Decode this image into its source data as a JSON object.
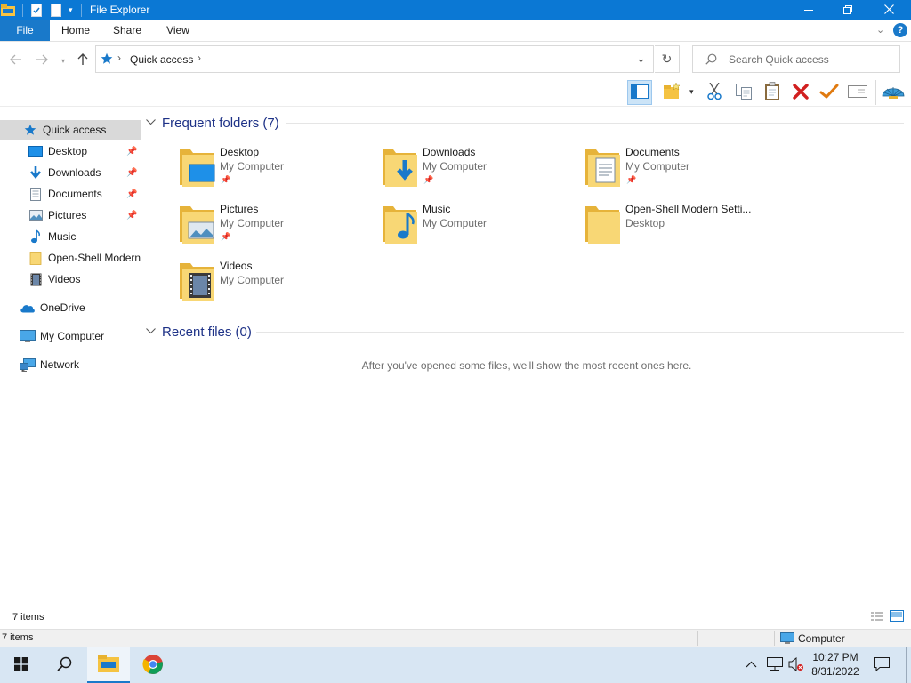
{
  "window": {
    "title": "File Explorer",
    "accent": "#0b78d4"
  },
  "ribbon": {
    "tabs": [
      {
        "label": "File"
      },
      {
        "label": "Home"
      },
      {
        "label": "Share"
      },
      {
        "label": "View"
      }
    ],
    "help_label": "?"
  },
  "address": {
    "breadcrumb": "Quick access",
    "search_placeholder": "Search Quick access"
  },
  "navpane": {
    "quick_access": "Quick access",
    "items": [
      {
        "label": "Desktop",
        "pinned": true
      },
      {
        "label": "Downloads",
        "pinned": true
      },
      {
        "label": "Documents",
        "pinned": true
      },
      {
        "label": "Pictures",
        "pinned": true
      },
      {
        "label": "Music",
        "pinned": false
      },
      {
        "label": "Open-Shell Modern",
        "pinned": false
      },
      {
        "label": "Videos",
        "pinned": false
      }
    ],
    "onedrive": "OneDrive",
    "my_computer": "My Computer",
    "network": "Network"
  },
  "frequent": {
    "heading": "Frequent folders (7)",
    "folders": [
      {
        "name": "Desktop",
        "location": "My Computer",
        "pinned": true,
        "icon": "desktop-icon"
      },
      {
        "name": "Downloads",
        "location": "My Computer",
        "pinned": true,
        "icon": "download-arrow-icon"
      },
      {
        "name": "Documents",
        "location": "My Computer",
        "pinned": true,
        "icon": "document-icon"
      },
      {
        "name": "Pictures",
        "location": "My Computer",
        "pinned": true,
        "icon": "picture-icon"
      },
      {
        "name": "Music",
        "location": "My Computer",
        "pinned": false,
        "icon": "music-note-icon"
      },
      {
        "name": "Open-Shell Modern Setti...",
        "location": "Desktop",
        "pinned": false,
        "icon": "folder-icon"
      },
      {
        "name": "Videos",
        "location": "My Computer",
        "pinned": false,
        "icon": "film-icon"
      }
    ]
  },
  "recent": {
    "heading": "Recent files (0)",
    "empty_message": "After you've opened some files, we'll show the most recent ones here."
  },
  "status": {
    "item_count": "7 items",
    "bottom_count": "7 items",
    "zone": "Computer"
  },
  "taskbar": {
    "time": "10:27 PM",
    "date": "8/31/2022",
    "color": "#d8e6f3"
  }
}
